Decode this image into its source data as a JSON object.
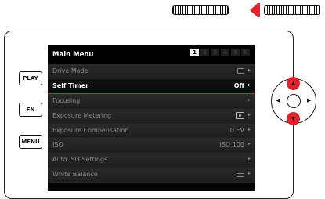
{
  "buttons": {
    "play": "PLAY",
    "fn": "FN",
    "menu": "MENU"
  },
  "menu": {
    "title": "Main Menu",
    "pages": [
      "1",
      "2",
      "3",
      "4",
      "5",
      "6"
    ],
    "active_page": 1,
    "items": [
      {
        "label": "Drive Mode",
        "value": "",
        "value_icon": "single-frame-icon"
      },
      {
        "label": "Self Timer",
        "value": "Off",
        "selected": true
      },
      {
        "label": "Focusing",
        "value": ""
      },
      {
        "label": "Exposure Metering",
        "value": "",
        "value_icon": "metering-icon"
      },
      {
        "label": "Exposure Compensation",
        "value": "0 EV"
      },
      {
        "label": "ISO",
        "value": "ISO 100"
      },
      {
        "label": "Auto ISO Settings",
        "value": ""
      },
      {
        "label": "White Balance",
        "value": "",
        "value_icon": "auto-wb-icon"
      }
    ]
  },
  "colors": {
    "accent": "#e0222b",
    "screen_bg": "#050505"
  }
}
